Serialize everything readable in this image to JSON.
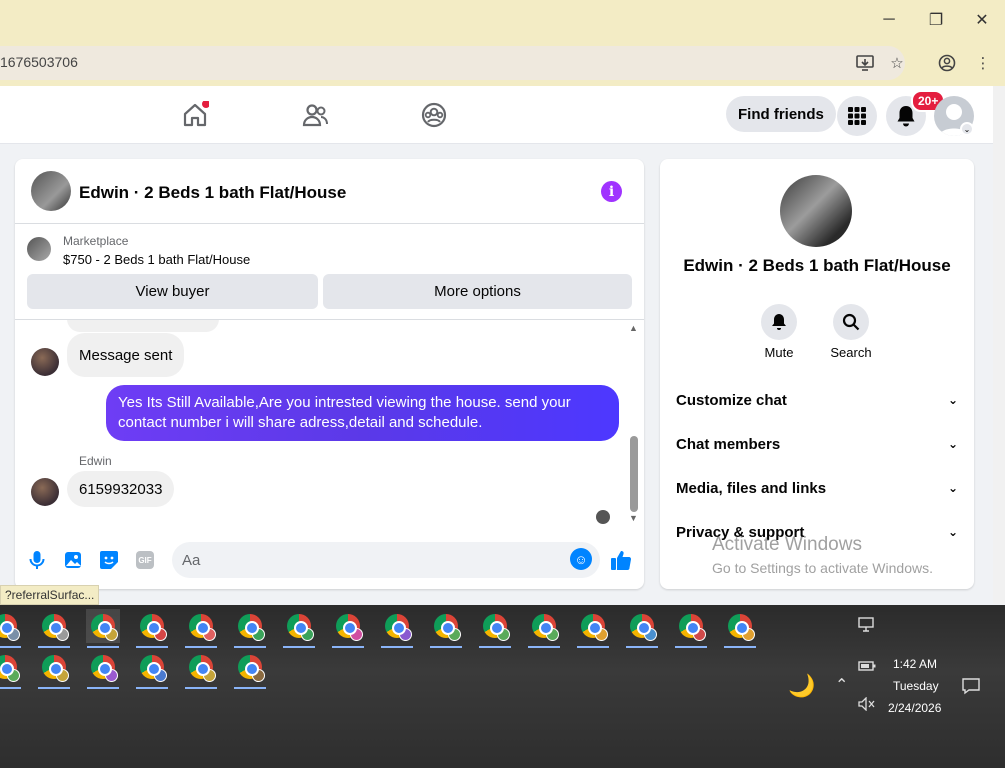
{
  "window": {
    "minimize": "─",
    "restore": "❐",
    "close": "✕"
  },
  "address": {
    "url_fragment": "1676503706"
  },
  "nav": {
    "find_friends": "Find friends",
    "notif_badge": "20+"
  },
  "chat": {
    "title": "Edwin · 2 Beds 1 bath Flat/House",
    "marketplace_label": "Marketplace",
    "listing": "$750 - 2 Beds 1 bath Flat/House",
    "view_buyer": "View buyer",
    "more_options": "More options",
    "messages": [
      {
        "side": "in",
        "text": "Message sent"
      },
      {
        "side": "out",
        "text": "Yes Its Still Available,Are you intrested viewing the house. send your contact number i will share adress,detail and schedule."
      },
      {
        "side": "in",
        "sender": "Edwin",
        "text": "6159932033"
      }
    ],
    "composer_placeholder": "Aa",
    "gif_label": "GIF"
  },
  "info_panel": {
    "title": "Edwin · 2 Beds 1 bath Flat/House",
    "mute_label": "Mute",
    "search_label": "Search",
    "rows": [
      "Customize chat",
      "Chat members",
      "Media, files and links",
      "Privacy & support"
    ]
  },
  "watermark": {
    "line1": "Activate Windows",
    "line2": "Go to Settings to activate Windows."
  },
  "status_tip": "?referralSurfac...",
  "taskbar": {
    "time": "1:42 AM",
    "day": "Tuesday",
    "date": "2/24/2026",
    "profile_colors_row1": [
      "#7a8fa8",
      "#9a9a9a",
      "#c5a43a",
      "#d64545",
      "#e06060",
      "#3aa35a",
      "#3aa35a",
      "#d04fa0",
      "#8a5ad0",
      "#5aaa5a",
      "#5aaa5a",
      "#5aaa5a",
      "#e0a030",
      "#4a90d0",
      "#d04a4a",
      "#e0a030"
    ],
    "profile_colors_row2": [
      "#5aaa5a",
      "#c5a43a",
      "#9a5ad0",
      "#4a7ad0",
      "#c5a43a",
      "#8a6a40"
    ]
  }
}
